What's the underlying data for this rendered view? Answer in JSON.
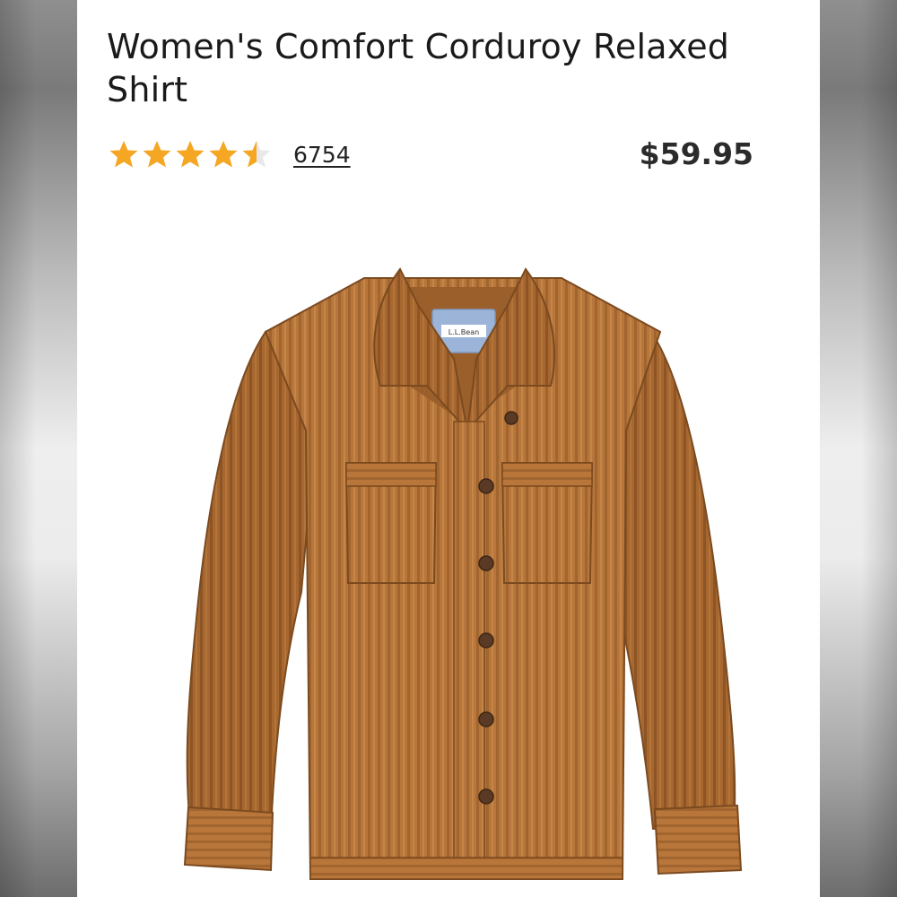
{
  "product": {
    "title": "Women's Comfort Corduroy Relaxed Shirt",
    "price": "$59.95",
    "rating": {
      "value": 4.5,
      "max": 5,
      "review_count": "6754",
      "star_color": "#f5a623"
    },
    "image": {
      "label_text": "L.L.Bean",
      "fabric_color": "#b8763a",
      "label_color": "#9cb4d8"
    }
  }
}
